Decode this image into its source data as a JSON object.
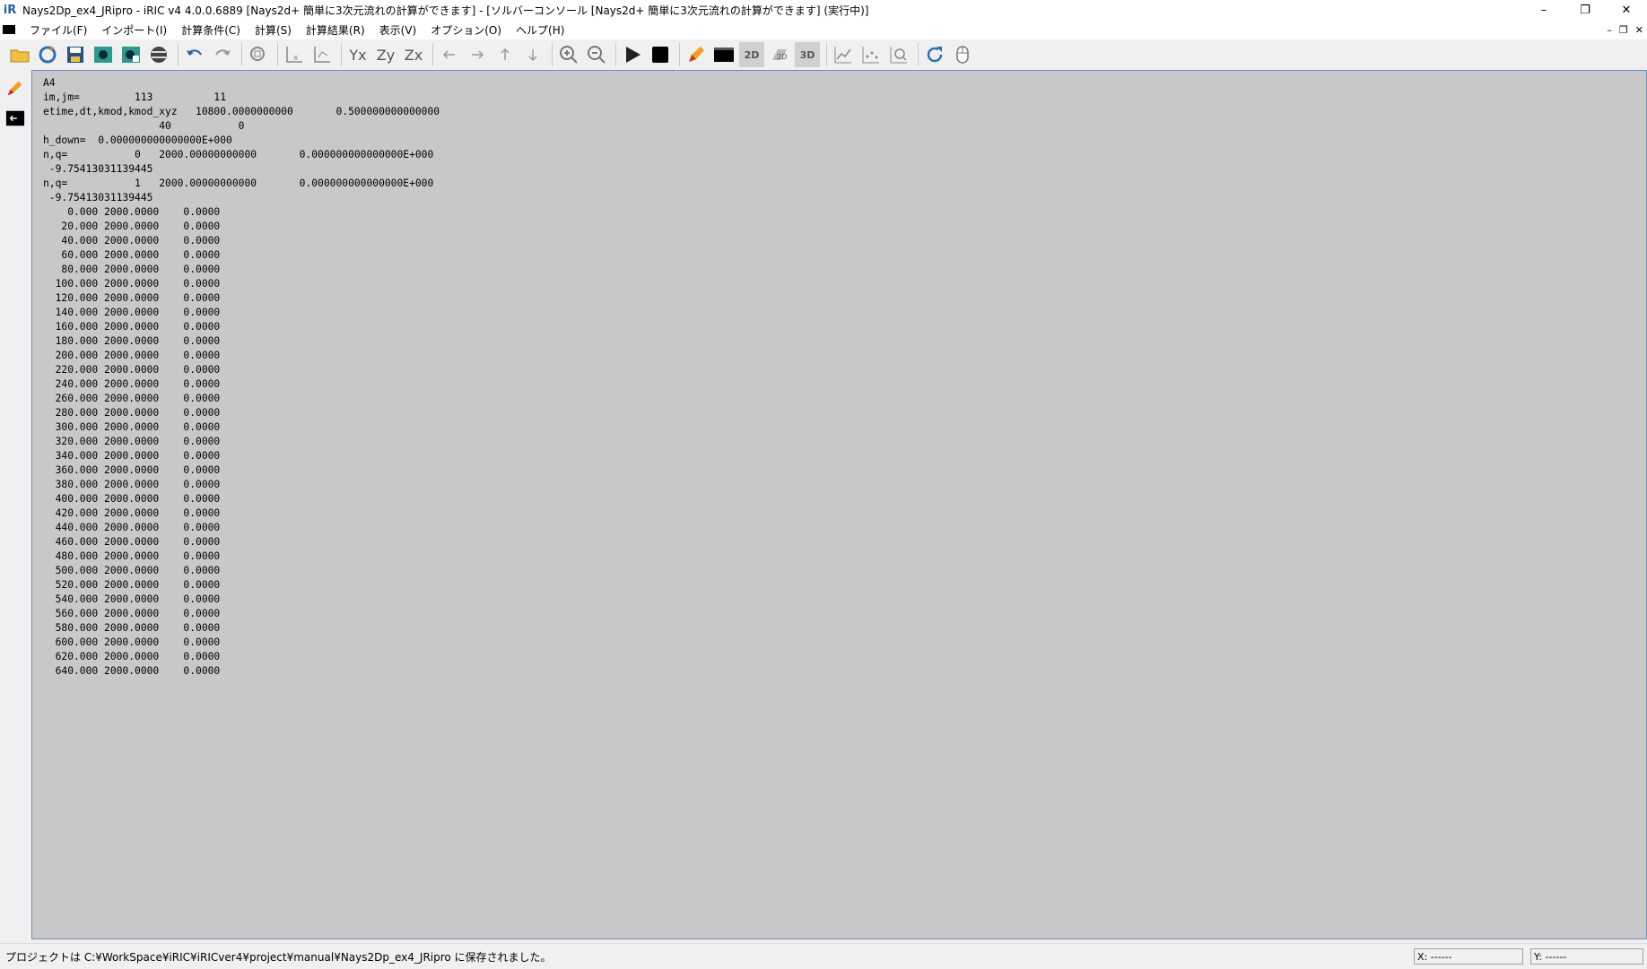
{
  "window": {
    "title": "Nays2Dp_ex4_JRipro - iRIC v4 4.0.0.6889 [Nays2d+ 簡単に3次元流れの計算ができます] - [ソルバーコンソール [Nays2d+ 簡単に3次元流れの計算ができます] (実行中)]",
    "minimize": "–",
    "restore": "❐",
    "close": "✕"
  },
  "menu": {
    "items": [
      {
        "label": "ファイル(F)"
      },
      {
        "label": "インポート(I)"
      },
      {
        "label": "計算条件(C)"
      },
      {
        "label": "計算(S)"
      },
      {
        "label": "計算結果(R)"
      },
      {
        "label": "表示(V)"
      },
      {
        "label": "オプション(O)"
      },
      {
        "label": "ヘルプ(H)"
      }
    ],
    "mdi_minimize": "–",
    "mdi_restore": "❐",
    "mdi_close": "✕"
  },
  "toolbar": {
    "icons": [
      "open-folder-icon",
      "refresh-icon",
      "save-icon",
      "snapshot-icon",
      "continuous-snapshot-icon",
      "globe-icon",
      "undo-icon",
      "redo-icon",
      "zoom-fit-icon",
      "axis-x-icon",
      "axis-xy-icon",
      "yx-icon",
      "zy-icon",
      "zx-icon",
      "arrow-left-icon",
      "arrow-right-icon",
      "arrow-up-icon",
      "arrow-down-icon",
      "zoom-in-icon",
      "zoom-out-icon",
      "run-icon",
      "stop-icon",
      "pencil-icon",
      "console-icon",
      "view-2d-icon",
      "view-2d-bird-icon",
      "view-3d-icon",
      "graph-icon",
      "scatter-icon",
      "graph-zoom-icon",
      "reload-icon",
      "mouse-icon"
    ],
    "labels": {
      "yx": "Yx",
      "zy": "Zy",
      "zx": "Zx",
      "v2d": "2D",
      "v3d": "3D"
    }
  },
  "console": {
    "lines": [
      "A4",
      "im,jm=         113          11",
      "etime,dt,kmod,kmod_xyz   10800.0000000000       0.500000000000000",
      "                   40           0",
      "h_down=  0.000000000000000E+000",
      "n,q=           0   2000.00000000000       0.000000000000000E+000",
      " -9.75413031139445",
      "n,q=           1   2000.00000000000       0.000000000000000E+000",
      " -9.75413031139445",
      "    0.000 2000.0000    0.0000",
      "   20.000 2000.0000    0.0000",
      "   40.000 2000.0000    0.0000",
      "   60.000 2000.0000    0.0000",
      "   80.000 2000.0000    0.0000",
      "  100.000 2000.0000    0.0000",
      "  120.000 2000.0000    0.0000",
      "  140.000 2000.0000    0.0000",
      "  160.000 2000.0000    0.0000",
      "  180.000 2000.0000    0.0000",
      "  200.000 2000.0000    0.0000",
      "  220.000 2000.0000    0.0000",
      "  240.000 2000.0000    0.0000",
      "  260.000 2000.0000    0.0000",
      "  280.000 2000.0000    0.0000",
      "  300.000 2000.0000    0.0000",
      "  320.000 2000.0000    0.0000",
      "  340.000 2000.0000    0.0000",
      "  360.000 2000.0000    0.0000",
      "  380.000 2000.0000    0.0000",
      "  400.000 2000.0000    0.0000",
      "  420.000 2000.0000    0.0000",
      "  440.000 2000.0000    0.0000",
      "  460.000 2000.0000    0.0000",
      "  480.000 2000.0000    0.0000",
      "  500.000 2000.0000    0.0000",
      "  520.000 2000.0000    0.0000",
      "  540.000 2000.0000    0.0000",
      "  560.000 2000.0000    0.0000",
      "  580.000 2000.0000    0.0000",
      "  600.000 2000.0000    0.0000",
      "  620.000 2000.0000    0.0000",
      "  640.000 2000.0000    0.0000"
    ]
  },
  "status": {
    "message": "プロジェクトは C:¥WorkSpace¥iRIC¥iRICver4¥project¥manual¥Nays2Dp_ex4_JRipro に保存されました。",
    "x": "X: ------",
    "y": "Y: ------"
  },
  "colors": {
    "console_bg": "#c8c8c8",
    "console_border": "#6d8fb5",
    "chrome_bg": "#f0f0f0"
  }
}
